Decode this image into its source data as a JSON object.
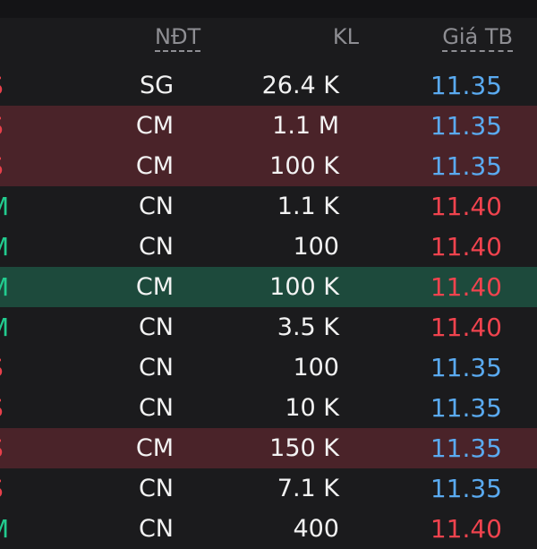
{
  "header": {
    "ndt": "NĐT",
    "kl": "KL",
    "gia_tb": "Giá TB"
  },
  "colors": {
    "background": "#1b1b1d",
    "buy_row": "#4a2329",
    "sell_row": "#1d4a3c",
    "price_up": "#f0434e",
    "price_down": "#5aaaf0",
    "side_red": "#e8404b",
    "side_green": "#22cc8f"
  },
  "rows": [
    {
      "side": "S",
      "ndt": "SG",
      "kl": "26.4 K",
      "price": "11.35"
    },
    {
      "side": "S",
      "ndt": "CM",
      "kl": "1.1 M",
      "price": "11.35"
    },
    {
      "side": "S",
      "ndt": "CM",
      "kl": "100 K",
      "price": "11.35"
    },
    {
      "side": "M",
      "ndt": "CN",
      "kl": "1.1 K",
      "price": "11.40"
    },
    {
      "side": "M",
      "ndt": "CN",
      "kl": "100",
      "price": "11.40"
    },
    {
      "side": "M",
      "ndt": "CM",
      "kl": "100 K",
      "price": "11.40"
    },
    {
      "side": "M",
      "ndt": "CN",
      "kl": "3.5 K",
      "price": "11.40"
    },
    {
      "side": "S",
      "ndt": "CN",
      "kl": "100",
      "price": "11.35"
    },
    {
      "side": "S",
      "ndt": "CN",
      "kl": "10 K",
      "price": "11.35"
    },
    {
      "side": "S",
      "ndt": "CM",
      "kl": "150 K",
      "price": "11.35"
    },
    {
      "side": "S",
      "ndt": "CN",
      "kl": "7.1 K",
      "price": "11.35"
    },
    {
      "side": "M",
      "ndt": "CN",
      "kl": "400",
      "price": "11.40"
    }
  ]
}
